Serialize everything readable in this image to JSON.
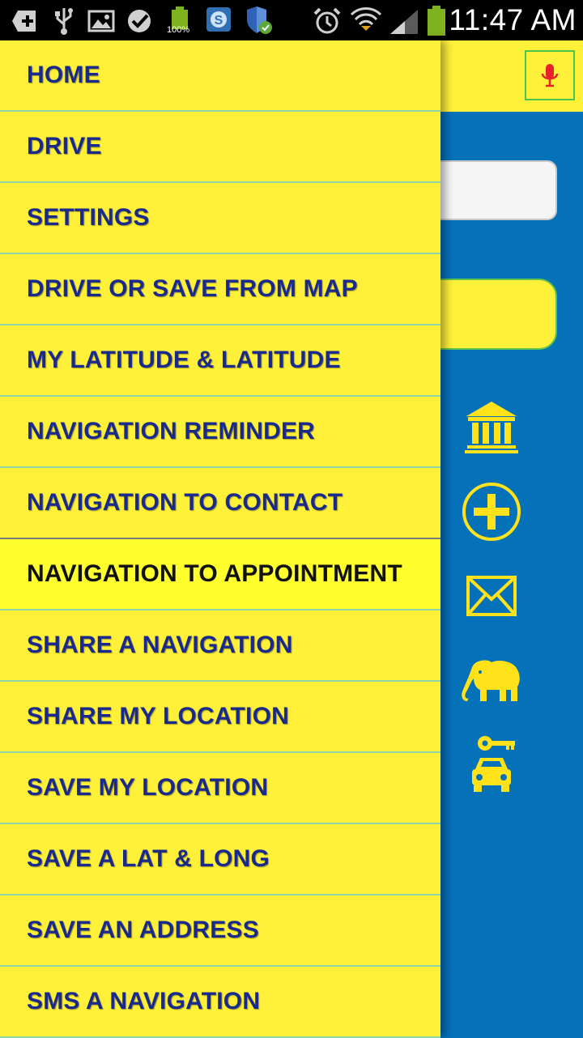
{
  "status_bar": {
    "time": "11:47 AM",
    "battery_level": "100%",
    "icons": [
      "add-icon",
      "usb-icon",
      "image-icon",
      "check-icon",
      "battery-icon",
      "skype-icon",
      "shield-icon",
      "alarm-icon",
      "wifi-icon",
      "signal-icon",
      "battery-icon"
    ]
  },
  "colors": {
    "drawer_bg": "#fff03a",
    "active_bg": "#ffff2e",
    "menu_text": "#1a2a8c",
    "app_bg": "#0571b9",
    "icon_yellow": "#ffe21a"
  },
  "menu": {
    "items": [
      {
        "label": "HOME"
      },
      {
        "label": "DRIVE"
      },
      {
        "label": "SETTINGS"
      },
      {
        "label": "DRIVE OR SAVE FROM MAP"
      },
      {
        "label": "MY LATITUDE & LATITUDE"
      },
      {
        "label": "NAVIGATION REMINDER"
      },
      {
        "label": "NAVIGATION TO CONTACT"
      },
      {
        "label": "NAVIGATION TO APPOINTMENT"
      },
      {
        "label": "SHARE A NAVIGATION"
      },
      {
        "label": "SHARE MY LOCATION"
      },
      {
        "label": "SAVE MY LOCATION"
      },
      {
        "label": "SAVE A LAT & LONG"
      },
      {
        "label": "SAVE AN ADDRESS"
      },
      {
        "label": "SMS A NAVIGATION"
      }
    ],
    "active_index": 7
  },
  "side_icons": [
    "bank-icon",
    "plus-circle-icon",
    "mail-icon",
    "elephant-icon",
    "car-key-icon"
  ]
}
